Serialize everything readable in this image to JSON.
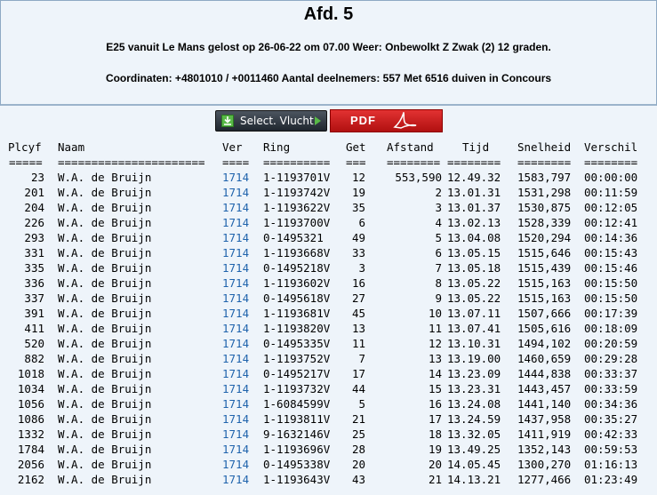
{
  "header": {
    "title": "Afd. 5",
    "line1": "E25 vanuit Le Mans gelost op 26-06-22 om 07.00 Weer: Onbewolkt Z Zwak (2) 12 graden.",
    "line2": "Coordinaten: +4801010 / +0011460 Aantal deelnemers: 557 Met 6516 duiven in Concours"
  },
  "buttons": {
    "select_vlucht": "Select. Vlucht",
    "pdf": "PDF"
  },
  "table": {
    "columns": [
      "Plcyf",
      "Naam",
      "Ver",
      "Ring",
      "Get",
      "Afstand",
      "Tijd",
      "Snelheid",
      "Verschil"
    ],
    "separators": [
      "=====",
      "======================",
      "====",
      "==========",
      "===",
      "========",
      "========",
      "========",
      "========"
    ],
    "rows": [
      {
        "plc": "23",
        "naam": "W.A. de Bruijn",
        "ver": "1714",
        "ring": "1-1193701V",
        "get": "12",
        "afst": "553,590",
        "tijd": "12.49.32",
        "snel": "1583,797",
        "vers": "00:00:00"
      },
      {
        "plc": "201",
        "naam": "W.A. de Bruijn",
        "ver": "1714",
        "ring": "1-1193742V",
        "get": "19",
        "afst": "2",
        "tijd": "13.01.31",
        "snel": "1531,298",
        "vers": "00:11:59"
      },
      {
        "plc": "204",
        "naam": "W.A. de Bruijn",
        "ver": "1714",
        "ring": "1-1193622V",
        "get": "35",
        "afst": "3",
        "tijd": "13.01.37",
        "snel": "1530,875",
        "vers": "00:12:05"
      },
      {
        "plc": "226",
        "naam": "W.A. de Bruijn",
        "ver": "1714",
        "ring": "1-1193700V",
        "get": "6",
        "afst": "4",
        "tijd": "13.02.13",
        "snel": "1528,339",
        "vers": "00:12:41"
      },
      {
        "plc": "293",
        "naam": "W.A. de Bruijn",
        "ver": "1714",
        "ring": "0-1495321",
        "get": "49",
        "afst": "5",
        "tijd": "13.04.08",
        "snel": "1520,294",
        "vers": "00:14:36"
      },
      {
        "plc": "331",
        "naam": "W.A. de Bruijn",
        "ver": "1714",
        "ring": "1-1193668V",
        "get": "33",
        "afst": "6",
        "tijd": "13.05.15",
        "snel": "1515,646",
        "vers": "00:15:43"
      },
      {
        "plc": "335",
        "naam": "W.A. de Bruijn",
        "ver": "1714",
        "ring": "0-1495218V",
        "get": "3",
        "afst": "7",
        "tijd": "13.05.18",
        "snel": "1515,439",
        "vers": "00:15:46"
      },
      {
        "plc": "336",
        "naam": "W.A. de Bruijn",
        "ver": "1714",
        "ring": "1-1193602V",
        "get": "16",
        "afst": "8",
        "tijd": "13.05.22",
        "snel": "1515,163",
        "vers": "00:15:50"
      },
      {
        "plc": "337",
        "naam": "W.A. de Bruijn",
        "ver": "1714",
        "ring": "0-1495618V",
        "get": "27",
        "afst": "9",
        "tijd": "13.05.22",
        "snel": "1515,163",
        "vers": "00:15:50"
      },
      {
        "plc": "391",
        "naam": "W.A. de Bruijn",
        "ver": "1714",
        "ring": "1-1193681V",
        "get": "45",
        "afst": "10",
        "tijd": "13.07.11",
        "snel": "1507,666",
        "vers": "00:17:39"
      },
      {
        "plc": "411",
        "naam": "W.A. de Bruijn",
        "ver": "1714",
        "ring": "1-1193820V",
        "get": "13",
        "afst": "11",
        "tijd": "13.07.41",
        "snel": "1505,616",
        "vers": "00:18:09"
      },
      {
        "plc": "520",
        "naam": "W.A. de Bruijn",
        "ver": "1714",
        "ring": "0-1495335V",
        "get": "11",
        "afst": "12",
        "tijd": "13.10.31",
        "snel": "1494,102",
        "vers": "00:20:59"
      },
      {
        "plc": "882",
        "naam": "W.A. de Bruijn",
        "ver": "1714",
        "ring": "1-1193752V",
        "get": "7",
        "afst": "13",
        "tijd": "13.19.00",
        "snel": "1460,659",
        "vers": "00:29:28"
      },
      {
        "plc": "1018",
        "naam": "W.A. de Bruijn",
        "ver": "1714",
        "ring": "0-1495217V",
        "get": "17",
        "afst": "14",
        "tijd": "13.23.09",
        "snel": "1444,838",
        "vers": "00:33:37"
      },
      {
        "plc": "1034",
        "naam": "W.A. de Bruijn",
        "ver": "1714",
        "ring": "1-1193732V",
        "get": "44",
        "afst": "15",
        "tijd": "13.23.31",
        "snel": "1443,457",
        "vers": "00:33:59"
      },
      {
        "plc": "1056",
        "naam": "W.A. de Bruijn",
        "ver": "1714",
        "ring": "1-6084599V",
        "get": "5",
        "afst": "16",
        "tijd": "13.24.08",
        "snel": "1441,140",
        "vers": "00:34:36"
      },
      {
        "plc": "1086",
        "naam": "W.A. de Bruijn",
        "ver": "1714",
        "ring": "1-1193811V",
        "get": "21",
        "afst": "17",
        "tijd": "13.24.59",
        "snel": "1437,958",
        "vers": "00:35:27"
      },
      {
        "plc": "1332",
        "naam": "W.A. de Bruijn",
        "ver": "1714",
        "ring": "9-1632146V",
        "get": "25",
        "afst": "18",
        "tijd": "13.32.05",
        "snel": "1411,919",
        "vers": "00:42:33"
      },
      {
        "plc": "1784",
        "naam": "W.A. de Bruijn",
        "ver": "1714",
        "ring": "1-1193696V",
        "get": "28",
        "afst": "19",
        "tijd": "13.49.25",
        "snel": "1352,143",
        "vers": "00:59:53"
      },
      {
        "plc": "2056",
        "naam": "W.A. de Bruijn",
        "ver": "1714",
        "ring": "0-1495338V",
        "get": "20",
        "afst": "20",
        "tijd": "14.05.45",
        "snel": "1300,270",
        "vers": "01:16:13"
      },
      {
        "plc": "2162",
        "naam": "W.A. de Bruijn",
        "ver": "1714",
        "ring": "1-1193643V",
        "get": "43",
        "afst": "21",
        "tijd": "14.13.21",
        "snel": "1277,466",
        "vers": "01:23:49"
      }
    ]
  }
}
